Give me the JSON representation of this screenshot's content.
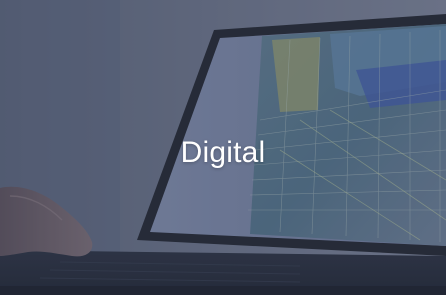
{
  "scene": {
    "subject": "laptop-with-cad-model-screen",
    "overlay_color": "#3f4a66"
  },
  "label": {
    "text": "Digital"
  }
}
